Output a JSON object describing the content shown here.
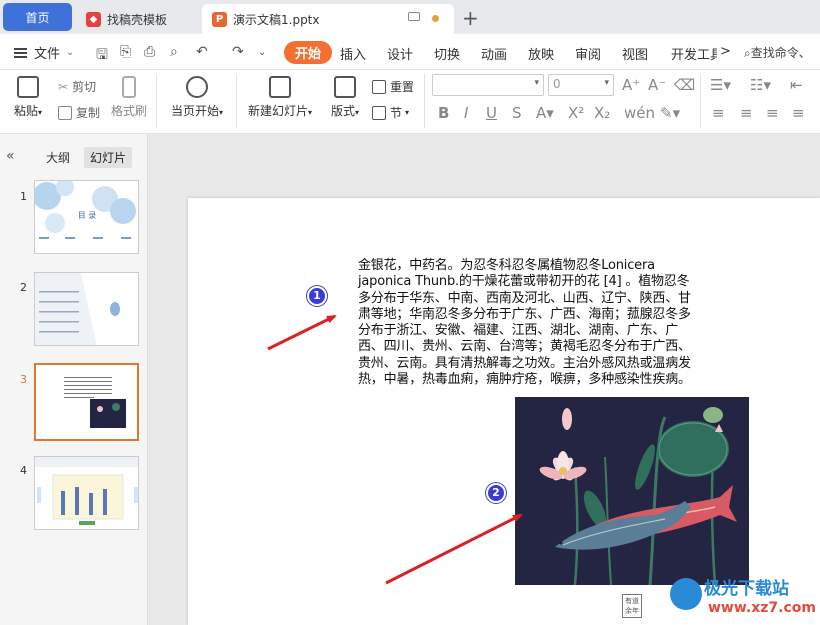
{
  "tabs": {
    "home": "首页",
    "zhaogao": "找稿壳模板",
    "doc": "演示文稿1.pptx",
    "plus": "+"
  },
  "menu": {
    "file": "文件",
    "tabs": [
      "开始",
      "插入",
      "设计",
      "切换",
      "动画",
      "放映",
      "审阅",
      "视图",
      "开发工具"
    ],
    "more": ">",
    "search": "查找命令、"
  },
  "ribbon": {
    "paste": "粘贴",
    "cut": "剪切",
    "copy": "复制",
    "format_painter": "格式刷",
    "from_current": "当页开始",
    "new_slide": "新建幻灯片",
    "layout": "版式",
    "reset": "重置",
    "section": "节",
    "font_size_value": "0"
  },
  "leftpanel": {
    "outline_tab": "大纲",
    "slides_tab": "幻灯片",
    "slide_numbers": [
      "1",
      "2",
      "3",
      "4"
    ],
    "thumb1_title": "目 录"
  },
  "slide": {
    "text": "金银花，中药名。为忍冬科忍冬属植物忍冬Lonicera japonica Thunb.的干燥花蕾或带初开的花 [4] 。植物忍冬多分布于华东、中南、西南及河北、山西、辽宁、陕西、甘肃等地；华南忍冬多分布于广东、广西、海南；菰腺忍冬多分布于浙江、安徽、福建、江西、湖北、湖南、广东、广西、四川、贵州、云南、台湾等；黄褐毛忍冬分布于广西、贵州、云南。具有清热解毒之功效。主治外感风热或温病发热，中暑，热毒血痢，痈肿疔疮，喉痹，多种感染性疾病。",
    "stamp": "有道 余年"
  },
  "annotations": {
    "badge1": "1",
    "badge2": "2"
  },
  "watermark": {
    "title": "极光下载站",
    "url": "www.xz7.com"
  },
  "colors": {
    "accent_orange": "#f36f32",
    "home_tab": "#3f72d8",
    "badge": "#3b3bd6",
    "arrow": "#d92323"
  }
}
